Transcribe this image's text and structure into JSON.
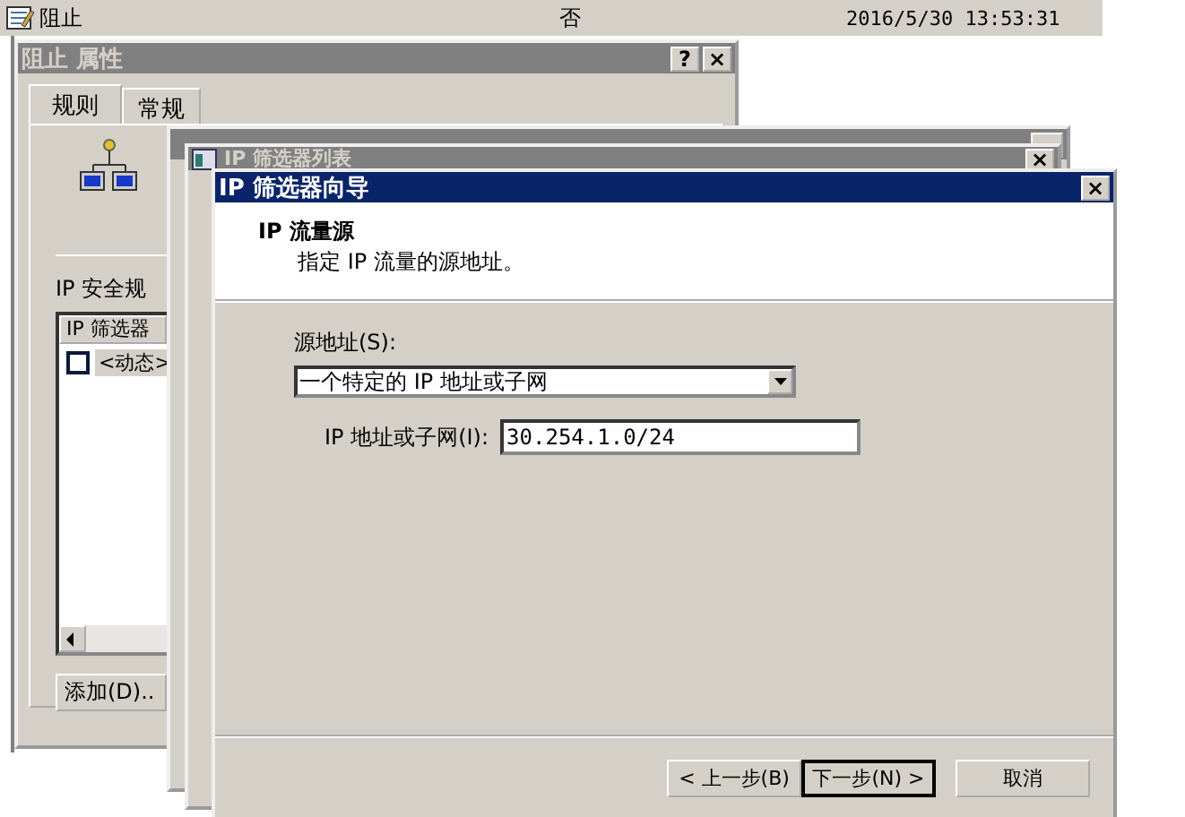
{
  "background_row": {
    "name": "阻止",
    "column_2": "否",
    "column_3": "2016/5/30 13:53:31"
  },
  "properties_window": {
    "title": "阻止 属性",
    "help_button": "?",
    "close_button": "×",
    "tabs": [
      {
        "label": "规则",
        "selected": true
      },
      {
        "label": "常规",
        "selected": false
      }
    ],
    "rules_label": "IP 安全规",
    "list": {
      "column_1": "IP 筛选器",
      "rows": [
        {
          "label": "<动态>",
          "checked": false,
          "selected": true
        }
      ]
    },
    "add_button": "添加(D).."
  },
  "filter_list_window": {
    "title": "IP 筛选器列表",
    "close_button": "×"
  },
  "wizard": {
    "title": "IP 筛选器向导",
    "close_button": "×",
    "heading": "IP 流量源",
    "subheading": "指定 IP 流量的源地址。",
    "source_label": "源地址(S):",
    "source_value": "一个特定的 IP 地址或子网",
    "address_label": "IP 地址或子网(I):",
    "address_value": "30.254.1.0/24",
    "buttons": [
      {
        "label": "< 上一步(B)",
        "default": false
      },
      {
        "label": "下一步(N) >",
        "default": true
      },
      {
        "label": "取消",
        "default": false
      }
    ]
  }
}
